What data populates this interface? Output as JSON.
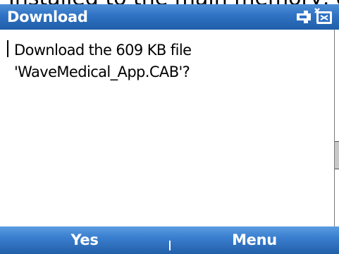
{
  "background_text": "Installed to the main memory, or you",
  "titlebar": {
    "title": "Download",
    "icon": "connectivity-icon"
  },
  "dialog": {
    "message_line1": "Download the 609 KB file",
    "message_line2": "'WaveMedical_App.CAB'?"
  },
  "softkeys": {
    "left_label": "Yes",
    "right_label": "Menu"
  },
  "colors": {
    "titlebar": "#2f72c4",
    "softkey_bar": "#3a7fcf",
    "text_on_bar": "#ffffff"
  }
}
